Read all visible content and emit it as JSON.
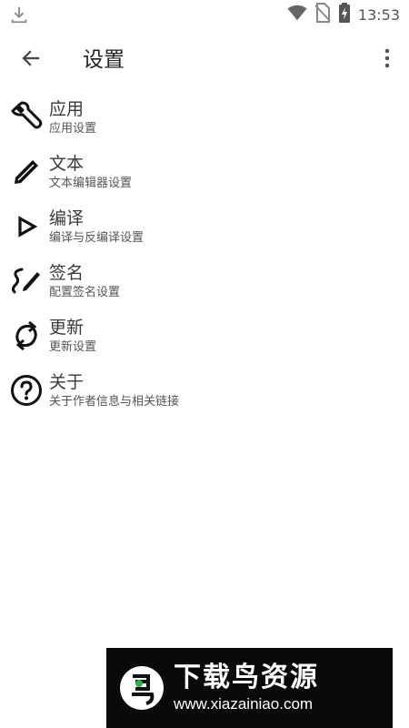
{
  "status_bar": {
    "time": "13:53",
    "icons": [
      "download-icon",
      "wifi-icon",
      "no-sim-icon",
      "battery-charging-icon"
    ]
  },
  "app_bar": {
    "title": "设置",
    "back_icon": "arrow-back-icon",
    "overflow_icon": "more-vert-icon"
  },
  "settings": [
    {
      "title": "应用",
      "subtitle": "应用设置",
      "icon": "wrench-icon"
    },
    {
      "title": "文本",
      "subtitle": "文本编辑器设置",
      "icon": "pencil-icon"
    },
    {
      "title": "编译",
      "subtitle": "编译与反编译设置",
      "icon": "play-outline-icon"
    },
    {
      "title": "签名",
      "subtitle": "配置签名设置",
      "icon": "signature-icon"
    },
    {
      "title": "更新",
      "subtitle": "更新设置",
      "icon": "sync-icon"
    },
    {
      "title": "关于",
      "subtitle": "关于作者信息与相关链接",
      "icon": "help-circle-icon"
    }
  ],
  "watermark": {
    "title": "下载鸟资源",
    "url": "www.xiazainiao.com"
  }
}
